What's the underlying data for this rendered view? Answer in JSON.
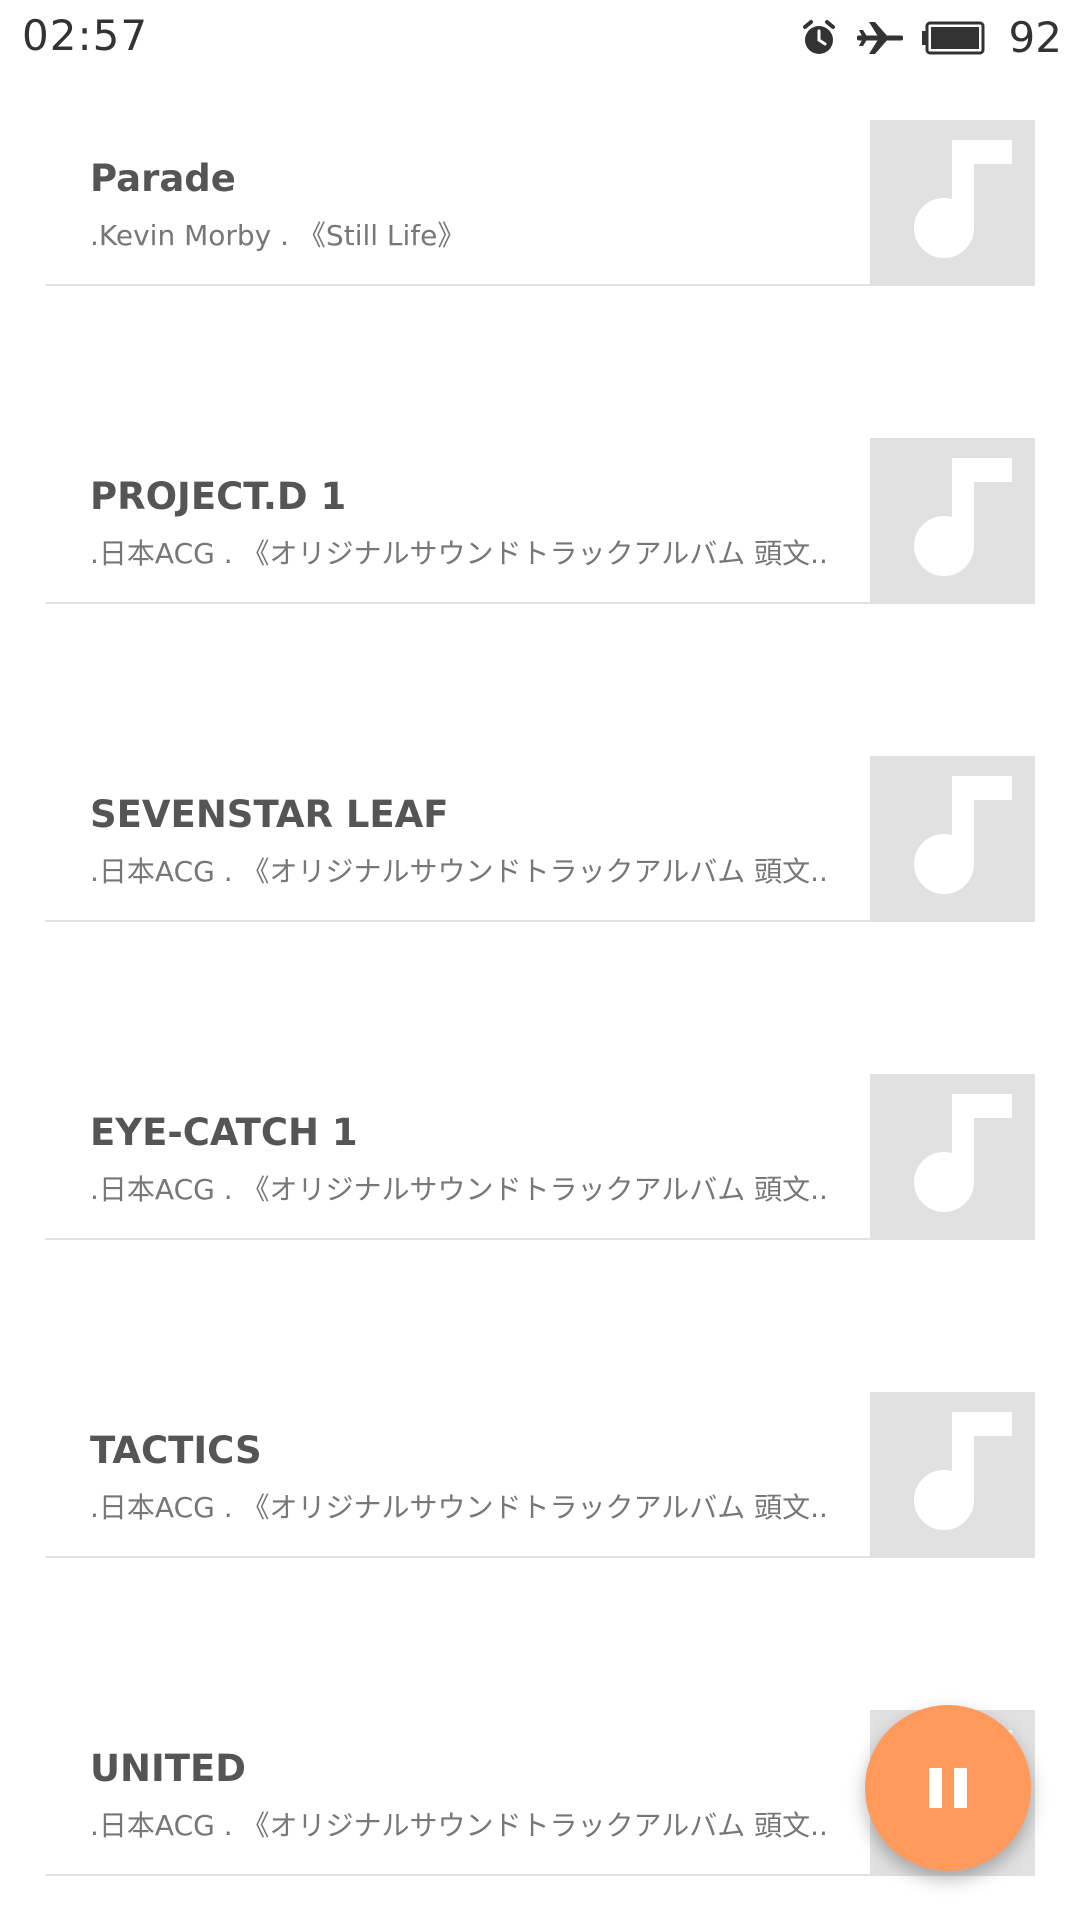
{
  "status_bar": {
    "time": "02:57",
    "battery_level": "92",
    "icons": [
      "alarm-icon",
      "airplane-mode-icon",
      "battery-icon"
    ]
  },
  "songs": [
    {
      "title": "Parade",
      "subtitle": ".Kevin Morby . 《Still Life》",
      "art_icon": "music-note-icon"
    },
    {
      "title": "PROJECT.D 1",
      "subtitle": ".日本ACG . 《オリジナルサウンドトラックアルバム 頭文..",
      "art_icon": "music-note-icon"
    },
    {
      "title": "SEVENSTAR LEAF",
      "subtitle": ".日本ACG . 《オリジナルサウンドトラックアルバム 頭文..",
      "art_icon": "music-note-icon"
    },
    {
      "title": "EYE-CATCH 1",
      "subtitle": ".日本ACG . 《オリジナルサウンドトラックアルバム 頭文..",
      "art_icon": "music-note-icon"
    },
    {
      "title": "TACTICS",
      "subtitle": ".日本ACG . 《オリジナルサウンドトラックアルバム 頭文..",
      "art_icon": "music-note-icon"
    },
    {
      "title": "UNITED",
      "subtitle": ".日本ACG . 《オリジナルサウンドトラックアルバム 頭文..",
      "art_icon": "music-note-icon"
    }
  ],
  "fab": {
    "icon": "pause-icon",
    "color": "#ff9a5c"
  },
  "colors": {
    "title_text": "#555555",
    "subtitle_text": "#777777",
    "art_placeholder": "#e1e1e1",
    "divider": "#e2e2e2"
  }
}
